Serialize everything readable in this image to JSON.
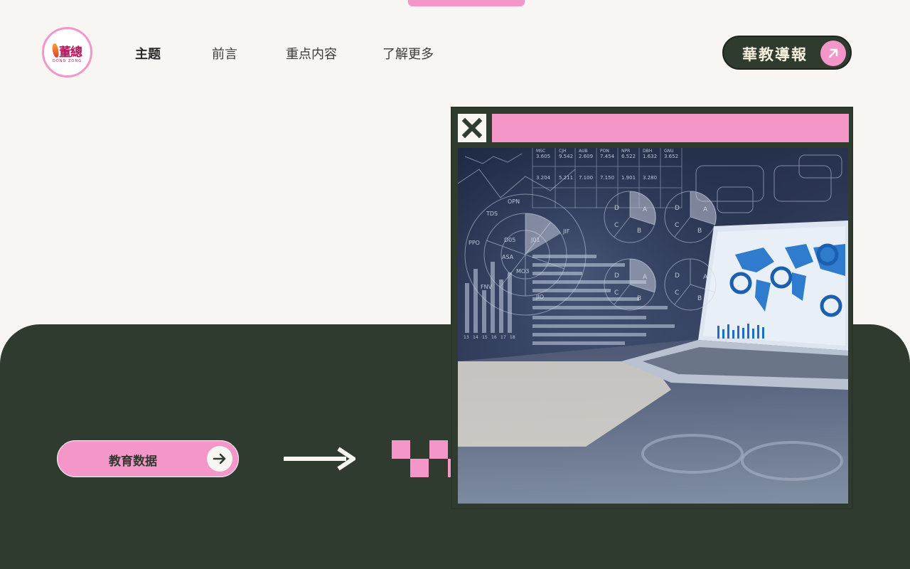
{
  "brand": {
    "logo_text": "董總",
    "logo_sub": "DONG ZONG"
  },
  "nav": {
    "items": [
      {
        "label": "主题",
        "active": true
      },
      {
        "label": "前言",
        "active": false
      },
      {
        "label": "重点内容",
        "active": false
      },
      {
        "label": "了解更多",
        "active": false
      }
    ]
  },
  "header_button": {
    "label": "華教導報",
    "icon": "arrow-up-right-icon"
  },
  "main": {
    "edu_button_label": "教育数据",
    "edu_button_icon": "arrow-right-icon"
  },
  "window": {
    "close_icon": "close-icon"
  },
  "photo": {
    "table_headers": [
      "MSC",
      "CJH",
      "AUB",
      "PON",
      "NPR",
      "DBH",
      "GNU"
    ],
    "table_values": [
      "3.605",
      "9.542",
      "2.609",
      "7.454",
      "6.522",
      "1.632",
      "3.652"
    ],
    "table_values_2": [
      "3.204",
      "5.211",
      "7.100",
      "7.150",
      "1.901",
      "3.280"
    ],
    "donut_labels": [
      "TDS",
      "OPN",
      "PPO",
      "J01",
      "D05",
      "JIF",
      "FNV",
      "MO3",
      "ASA",
      "JIO"
    ],
    "pie_letters": [
      "A",
      "B",
      "C",
      "D"
    ],
    "axis_ticks": [
      "13",
      "14",
      "15",
      "16",
      "17",
      "18"
    ]
  },
  "colors": {
    "pink": "#f497c8",
    "dark_green": "#2f3b2f",
    "cream": "#f8f6f3"
  }
}
